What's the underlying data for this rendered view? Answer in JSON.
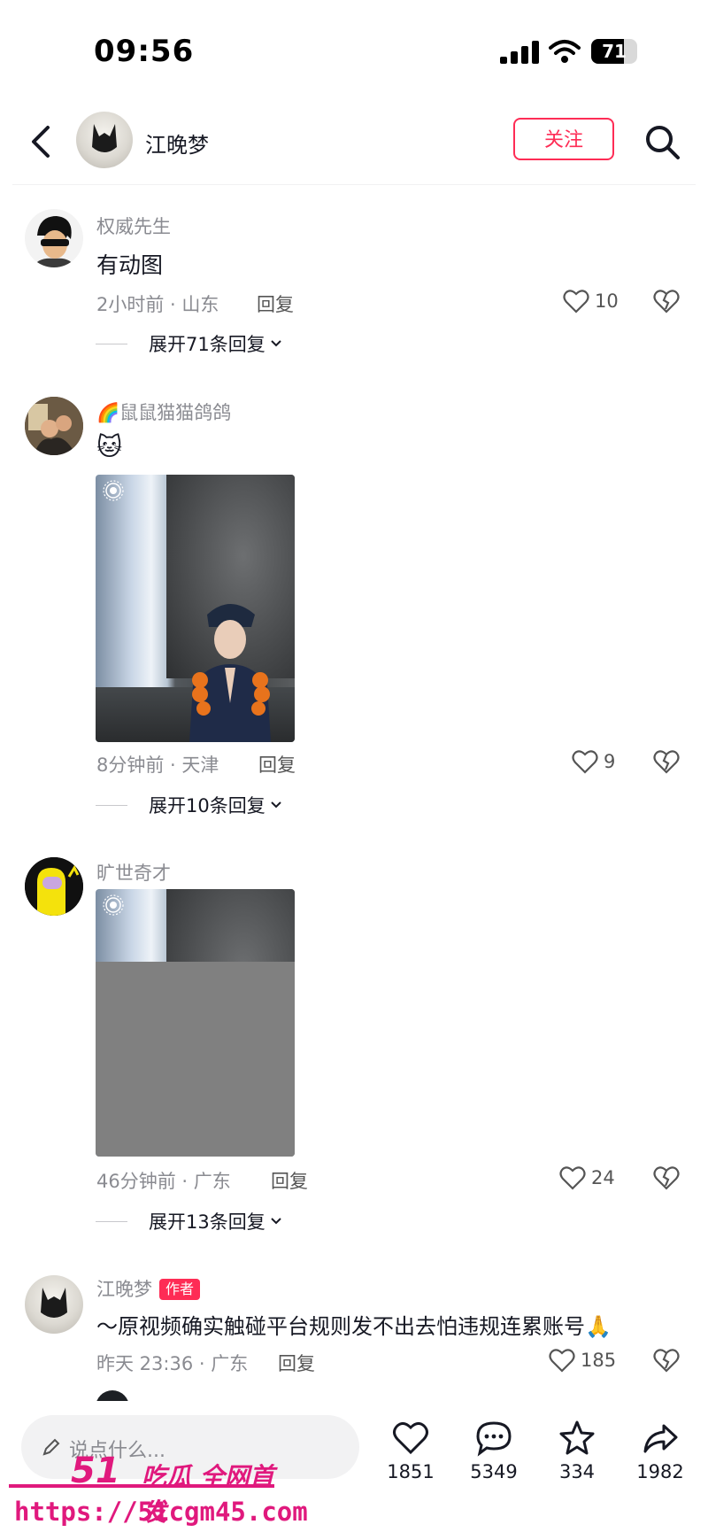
{
  "status_bar": {
    "time": "09:56",
    "battery": "71",
    "battery_level": 0.71
  },
  "header": {
    "name": "江晚梦",
    "follow_label": "关注"
  },
  "comments": [
    {
      "user": "权威先生",
      "text": "有动图",
      "meta": "2小时前 · 山东",
      "reply": "回复",
      "likes": "10",
      "expand": "展开71条回复"
    },
    {
      "user": "🌈鼠鼠猫猫鸽鸽",
      "text": "🐱",
      "meta": "8分钟前 · 天津",
      "reply": "回复",
      "likes": "9",
      "expand": "展开10条回复"
    },
    {
      "user": "旷世奇才",
      "meta": "46分钟前 · 广东",
      "reply": "回复",
      "likes": "24",
      "expand": "展开13条回复"
    },
    {
      "user": "江晚梦",
      "badge": "作者",
      "text": "～原视频确实触碰平台规则发不出去怕违规连累账号🙏",
      "meta": "昨天 23:36 · 广东",
      "reply": "回复",
      "likes": "185"
    }
  ],
  "bottom_bar": {
    "placeholder": "说点什么...",
    "likes": "1851",
    "comments": "5349",
    "favorites": "334",
    "shares": "1982"
  },
  "watermark": {
    "logo": "51",
    "tag": "吃瓜 全网首发",
    "url": "https://51cgm45.com"
  },
  "colors": {
    "accent": "#fe2c55",
    "watermark": "#e0197d",
    "secondary_text": "#8a8b91"
  }
}
